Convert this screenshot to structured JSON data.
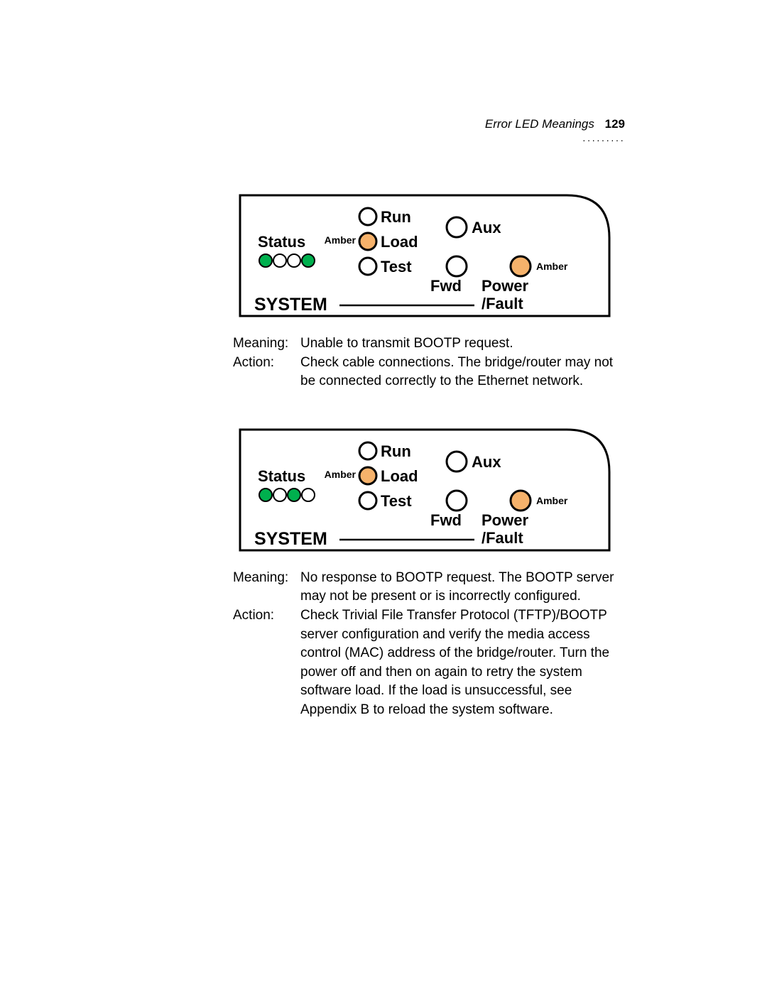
{
  "header": {
    "title": "Error LED Meanings",
    "page_number": "129"
  },
  "colors": {
    "green_led": "#00b04e",
    "amber_led": "#f6b26b",
    "stroke": "#000"
  },
  "labels": {
    "system": "SYSTEM",
    "status": "Status",
    "amber": "Amber",
    "run": "Run",
    "load": "Load",
    "test": "Test",
    "aux": "Aux",
    "fwd": "Fwd",
    "power_line1": "Power",
    "power_line2": "/Fault",
    "meaning_label": "Meaning:",
    "action_label": "Action:"
  },
  "entries": [
    {
      "meaning": "Unable to transmit BOOTP request.",
      "action": "Check cable connections. The bridge/router may not be connected correctly to the Ethernet network."
    },
    {
      "meaning": "No response to BOOTP request. The BOOTP server may not be present or is incorrectly configured.",
      "action": "Check Trivial File Transfer Protocol (TFTP)/BOOTP server configuration and verify the media access control (MAC) address of the bridge/router. Turn the power off and then on again to retry the system software load. If the load is unsuccessful, see Appendix B to reload the system software."
    }
  ]
}
